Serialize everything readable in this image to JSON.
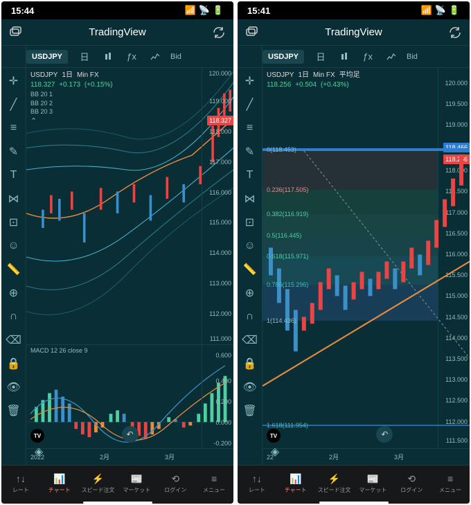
{
  "left": {
    "status_time": "15:44",
    "app_title": "TradingView",
    "symbol": "USDJPY",
    "bid": "Bid",
    "info": {
      "symbol": "USDJPY",
      "interval": "1日",
      "provider": "Min FX",
      "price": "118.327",
      "change": "+0.173",
      "pct": "(+0.15%)"
    },
    "bb": [
      "BB 20 1",
      "BB 20 2",
      "BB 20 3"
    ],
    "axis": [
      "120.000",
      "119.000",
      "118.000",
      "117.000",
      "116.000",
      "115.000",
      "114.000",
      "113.000",
      "112.000",
      "111.000"
    ],
    "price_tag": "118.327",
    "macd": {
      "label": "MACD 12 26 close 9",
      "axis": [
        "0.600",
        "0.400",
        "0.200",
        "0.000",
        "-0.200"
      ]
    },
    "months": [
      "2022",
      "2月",
      "3月"
    ],
    "nav": [
      "レート",
      "チャート",
      "スピード注文",
      "マーケット",
      "ログイン",
      "メニュー"
    ]
  },
  "right": {
    "status_time": "15:41",
    "app_title": "TradingView",
    "symbol": "USDJPY",
    "bid": "Bid",
    "info": {
      "symbol": "USDJPY",
      "interval": "1日",
      "provider": "Min FX",
      "extra": "平均足",
      "price": "118.256",
      "change": "+0.504",
      "pct": "(+0.43%)"
    },
    "axis": [
      "120.000",
      "119.500",
      "119.000",
      "118.500",
      "118.000",
      "117.500",
      "117.000",
      "116.500",
      "116.000",
      "115.500",
      "115.000",
      "114.500",
      "114.000",
      "113.500",
      "113.000",
      "112.500",
      "112.000",
      "111.500"
    ],
    "price_tags": {
      "blue": "118.466",
      "red": "118.256"
    },
    "fib": [
      {
        "label": "0(118.453)",
        "color": "#8bb"
      },
      {
        "label": "0.236(117.505)",
        "color": "#e84545"
      },
      {
        "label": "0.382(116.919)",
        "color": "#4dd0a0"
      },
      {
        "label": "0.5(116.445)",
        "color": "#4dd0a0"
      },
      {
        "label": "0.618(115.971)",
        "color": "#4dd0a0"
      },
      {
        "label": "0.786(115.296)",
        "color": "#4bb"
      },
      {
        "label": "1(114.436)",
        "color": "#8bb"
      },
      {
        "label": "1.618(111.954)",
        "color": "#4bb"
      }
    ],
    "months": [
      "22",
      "2月",
      "3月"
    ],
    "nav": [
      "レート",
      "チャート",
      "スピード注文",
      "マーケット",
      "ログイン",
      "メニュー"
    ]
  },
  "chart_data": [
    {
      "type": "candlestick",
      "title": "USDJPY 1日 Min FX (left)",
      "ylim": [
        111,
        120
      ],
      "last_price": 118.327,
      "indicators": [
        "Bollinger Bands (20,1/2/3)"
      ],
      "note": "daily candles Jan-Mar 2022, approximate range 113.5→118.3"
    },
    {
      "type": "macd",
      "title": "MACD 12 26 close 9",
      "ylim": [
        -0.2,
        0.6
      ],
      "note": "histogram oscillating around 0, rising at right edge"
    },
    {
      "type": "candlestick",
      "title": "USDJPY 1日 Min FX 平均足 (right)",
      "ylim": [
        111.5,
        120
      ],
      "last_price": 118.256,
      "overlays": [
        "Fibonacci retracement 0→1.618",
        "trendline"
      ],
      "fib_levels": {
        "0": 118.453,
        "0.236": 117.505,
        "0.382": 116.919,
        "0.5": 116.445,
        "0.618": 115.971,
        "0.786": 115.296,
        "1": 114.436,
        "1.618": 111.954
      }
    }
  ]
}
